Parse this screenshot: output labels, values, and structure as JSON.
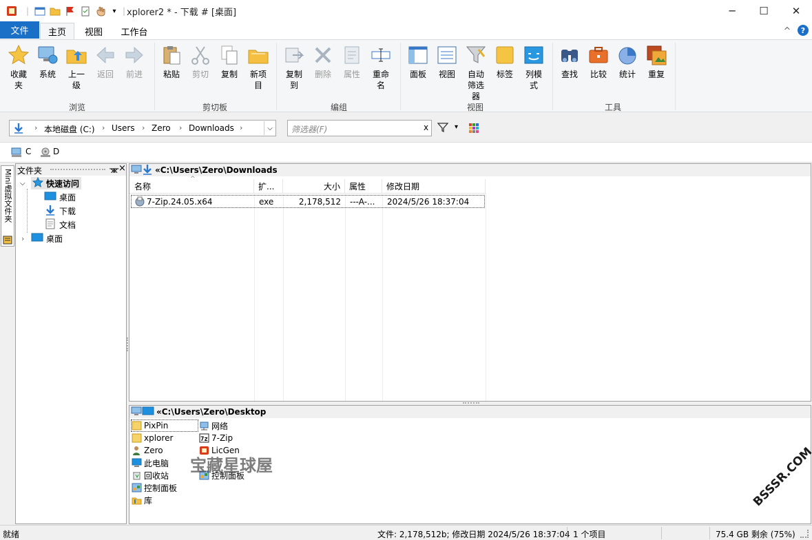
{
  "window": {
    "title": "xplorer2 * - 下载 # [桌面]",
    "minimize": "─",
    "maximize": "☐",
    "close": "✕"
  },
  "tabs": {
    "file": "文件",
    "home": "主页",
    "view": "视图",
    "workspace": "工作台",
    "collapse": "^",
    "help": "?"
  },
  "ribbon": {
    "browse": {
      "label": "浏览",
      "favorites": "收藏夹",
      "system": "系统",
      "up": "上一级",
      "back": "返回",
      "forward": "前进"
    },
    "clipboard": {
      "label": "剪切板",
      "paste": "粘贴",
      "cut": "剪切",
      "copy": "复制",
      "new_item": "新项目"
    },
    "edit": {
      "label": "编组",
      "copy_to": "复制到",
      "delete": "删除",
      "properties": "属性",
      "rename": "重命名"
    },
    "view": {
      "label": "视图",
      "panels": "面板",
      "view": "视图",
      "auto_filter": "自动筛选器",
      "bookmarks": "标签",
      "columns": "列模式"
    },
    "tools": {
      "label": "工具",
      "find": "查找",
      "compare": "比较",
      "stats": "统计",
      "duplicates": "重复"
    }
  },
  "address": {
    "path": [
      "本地磁盘 (C:)",
      "Users",
      "Zero",
      "Downloads"
    ],
    "filter_placeholder": "筛选器(F)",
    "clear": "x"
  },
  "drives": [
    "C",
    "D"
  ],
  "sidebar": {
    "vertical_tab": "Mini虚拟文件夹",
    "header": "文件夹",
    "pin": "ᚘ",
    "close": "×",
    "tree": {
      "quick_access": "快速访问",
      "desktop": "桌面",
      "downloads": "下载",
      "documents": "文档",
      "desktop_root": "桌面"
    }
  },
  "pane1": {
    "path": "«C:\\Users\\Zero\\Downloads",
    "columns": {
      "name": "名称",
      "ext": "扩...",
      "size": "大小",
      "attr": "属性",
      "modified": "修改日期"
    },
    "rows": [
      {
        "name": "7-Zip.24.05.x64",
        "ext": "exe",
        "size": "2,178,512",
        "attr": "---A-...",
        "modified": "2024/5/26 18:37:04"
      }
    ]
  },
  "pane2": {
    "path": "«C:\\Users\\Zero\\Desktop",
    "col1": [
      "PixPin",
      "xplorer",
      "Zero",
      "此电脑",
      "回收站",
      "控制面板",
      "库"
    ],
    "col2": [
      "网络",
      "7-Zip",
      "LicGen",
      "控制面板"
    ]
  },
  "watermark": {
    "text1": "宝藏星球屋",
    "text2": "BSSSR.COM"
  },
  "status": {
    "ready": "就绪",
    "file_info": "文件: 2,178,512b; 修改日期 2024/5/26 18:37:04",
    "count": "1 个项目",
    "disk": "75.4 GB 剩余 (75%)"
  },
  "colors": {
    "accent": "#1a6fc7",
    "folder": "#f5c042",
    "monitor": "#1e90e0"
  }
}
